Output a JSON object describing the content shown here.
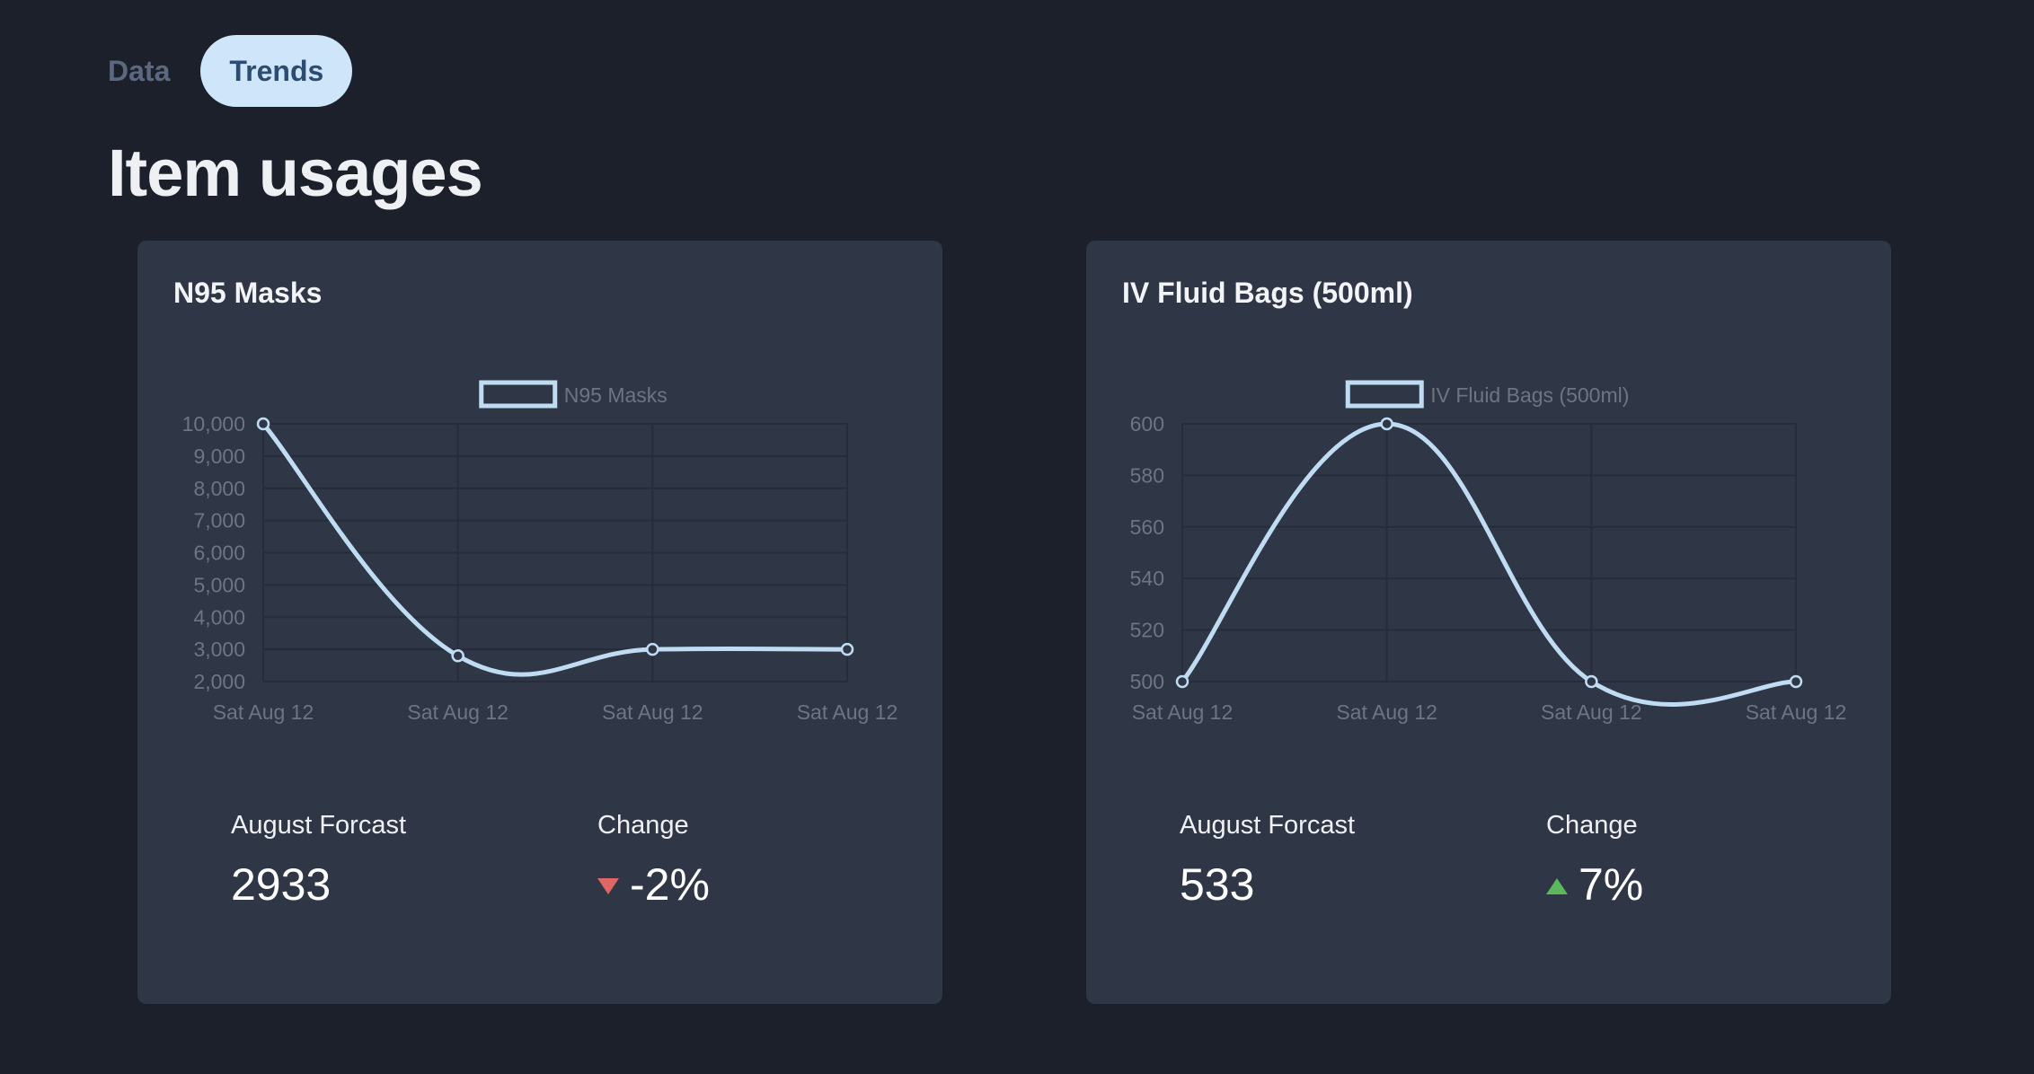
{
  "tabs": [
    {
      "label": "Data",
      "active": false
    },
    {
      "label": "Trends",
      "active": true
    }
  ],
  "page_title": "Item usages",
  "cards": [
    {
      "title": "N95 Masks",
      "forecast_label": "August Forcast",
      "forecast_value": "2933",
      "change_label": "Change",
      "change_value": "-2%",
      "change_direction": "down"
    },
    {
      "title": "IV Fluid Bags (500ml)",
      "forecast_label": "August Forcast",
      "forecast_value": "533",
      "change_label": "Change",
      "change_value": "7%",
      "change_direction": "up"
    }
  ],
  "colors": {
    "line": "#bfdcf3",
    "grid": "#262c39",
    "tick_text": "#6d7585",
    "arrow_down": "#e06666",
    "arrow_up": "#5cb85c"
  },
  "chart_data": [
    {
      "type": "line",
      "legend": "N95 Masks",
      "categories": [
        "Sat Aug 12",
        "Sat Aug 12",
        "Sat Aug 12",
        "Sat Aug 12"
      ],
      "values": [
        10000,
        2800,
        3000,
        3000
      ],
      "ylim": [
        2000,
        10000
      ],
      "yticks": [
        2000,
        3000,
        4000,
        5000,
        6000,
        7000,
        8000,
        9000,
        10000
      ],
      "ytick_labels": [
        "2,000",
        "3,000",
        "4,000",
        "5,000",
        "6,000",
        "7,000",
        "8,000",
        "9,000",
        "10,000"
      ],
      "grid": true,
      "legend_position": "top"
    },
    {
      "type": "line",
      "legend": "IV Fluid Bags (500ml)",
      "categories": [
        "Sat Aug 12",
        "Sat Aug 12",
        "Sat Aug 12",
        "Sat Aug 12"
      ],
      "values": [
        500,
        600,
        500,
        500
      ],
      "ylim": [
        500,
        600
      ],
      "yticks": [
        500,
        520,
        540,
        560,
        580,
        600
      ],
      "ytick_labels": [
        "500",
        "520",
        "540",
        "560",
        "580",
        "600"
      ],
      "grid": true,
      "legend_position": "top"
    }
  ]
}
